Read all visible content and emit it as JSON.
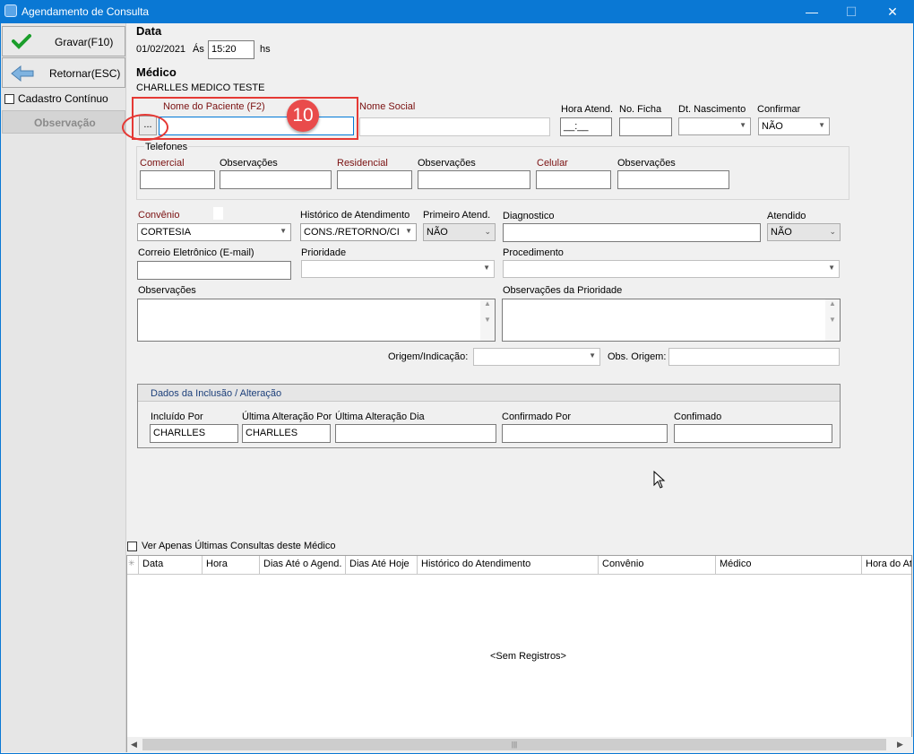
{
  "window": {
    "title": "Agendamento de Consulta",
    "minimize": "—",
    "maximize": "☐",
    "close": "✕"
  },
  "sidebar": {
    "save": "Gravar(F10)",
    "back": "Retornar(ESC)",
    "continuous": "Cadastro Contínuo",
    "observation": "Observação"
  },
  "header": {
    "date_title": "Data",
    "date": "01/02/2021",
    "at": "Ás",
    "time": "15:20",
    "hs": "hs",
    "doctor_title": "Médico",
    "doctor_name": "CHARLLES MEDICO TESTE"
  },
  "patient": {
    "name_label": "Nome do Paciente (F2)",
    "lookup": "...",
    "badge": "10",
    "social_label": "Nome Social",
    "hora_label": "Hora Atend.",
    "hora_value": "__:__",
    "ficha_label": "No. Ficha",
    "nasc_label": "Dt. Nascimento",
    "confirmar_label": "Confirmar",
    "confirmar_value": "NÃO"
  },
  "phones": {
    "title": "Telefones",
    "comercial": "Comercial",
    "obs1": "Observações",
    "residencial": "Residencial",
    "obs2": "Observações",
    "celular": "Celular",
    "obs3": "Observações"
  },
  "details": {
    "convenio_label": "Convênio",
    "convenio_value": "CORTESIA",
    "historico_label": "Histórico de Atendimento",
    "historico_value": "CONS./RETORNO/CI",
    "primeiro_label": "Primeiro Atend.",
    "primeiro_value": "NÃO",
    "diagnostico_label": "Diagnostico",
    "atendido_label": "Atendido",
    "atendido_value": "NÃO",
    "email_label": "Correio Eletrônico (E-mail)",
    "prioridade_label": "Prioridade",
    "procedimento_label": "Procedimento",
    "obs_label": "Observações",
    "obs_prior_label": "Observações da Prioridade",
    "origem_label": "Origem/Indicação:",
    "obs_origem_label": "Obs. Origem:"
  },
  "inclusion": {
    "title": "Dados da Inclusão / Alteração",
    "incluido_label": "Incluído Por",
    "incluido_value": "CHARLLES",
    "ult_alt_label": "Última Alteração Por",
    "ult_alt_value": "CHARLLES",
    "ult_dia_label": "Última Alteração Dia",
    "conf_por_label": "Confirmado Por",
    "confirmado_label": "Confimado"
  },
  "grid": {
    "checkbox_label": "Ver Apenas Últimas Consultas deste Médico",
    "marker": "✳",
    "columns": [
      "Data",
      "Hora",
      "Dias Até o Agend.",
      "Dias Até Hoje",
      "Histórico do Atendimento",
      "Convênio",
      "Médico",
      "Hora do Ate"
    ],
    "empty": "<Sem Registros>"
  },
  "colors": {
    "titlebar": "#0a78d4",
    "accent": "#7a1010",
    "badge": "#e94b4b",
    "highlight": "#e53935"
  }
}
